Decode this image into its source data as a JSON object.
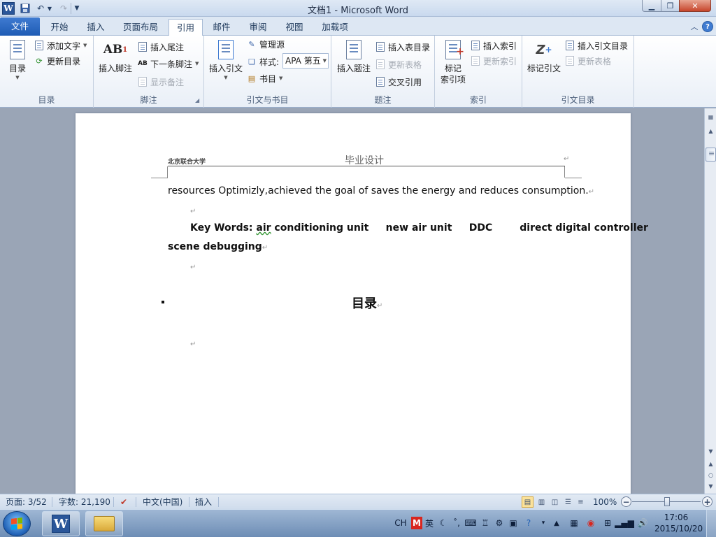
{
  "titlebar": {
    "title": "文档1 - Microsoft Word",
    "app_icon": "W"
  },
  "tabs": [
    {
      "label": "文件"
    },
    {
      "label": "开始"
    },
    {
      "label": "插入"
    },
    {
      "label": "页面布局"
    },
    {
      "label": "引用"
    },
    {
      "label": "邮件"
    },
    {
      "label": "审阅"
    },
    {
      "label": "视图"
    },
    {
      "label": "加载项"
    }
  ],
  "active_tab": "引用",
  "ribbon": {
    "toc": {
      "group_label": "目录",
      "toc_button": "目录",
      "add_text": "添加文字",
      "update_toc": "更新目录"
    },
    "footnotes": {
      "group_label": "脚注",
      "insert_footnote": "插入脚注",
      "insert_endnote": "插入尾注",
      "next_footnote": "下一条脚注",
      "show_notes": "显示备注"
    },
    "citations": {
      "group_label": "引文与书目",
      "insert_citation": "插入引文",
      "manage_sources": "管理源",
      "style_label": "样式:",
      "style_value": "APA 第五",
      "bibliography": "书目"
    },
    "captions": {
      "group_label": "题注",
      "insert_caption": "插入题注",
      "insert_table_of_figures": "插入表目录",
      "update_table": "更新表格",
      "cross_reference": "交叉引用"
    },
    "index": {
      "group_label": "索引",
      "mark_entry_line1": "标记",
      "mark_entry_line2": "索引项",
      "insert_index": "插入索引",
      "update_index": "更新索引"
    },
    "authorities": {
      "group_label": "引文目录",
      "mark_citation": "标记引文",
      "insert_toa": "插入引文目录",
      "update_table": "更新表格"
    }
  },
  "document": {
    "header_left": "北京联合大学",
    "header_center": "毕业设计",
    "para1": "resources Optimizly,achieved the goal of saves the energy and reduces consumption.",
    "kw_label": "Key Words:",
    "kw_first": "air",
    "kw_rest": " conditioning unit     new air unit     DDC        direct digital controller",
    "kw_line2": "scene debugging",
    "toc_heading": "目录",
    "mark": "↵"
  },
  "statusbar": {
    "page": "页面: 3/52",
    "words": "字数: 21,190",
    "language": "中文(中国)",
    "mode": "插入",
    "zoom": "100%",
    "zoom_minus": "−",
    "zoom_plus": "+"
  },
  "taskbar": {
    "tray_ch": "CH",
    "tray_m": "M",
    "tray_lang": "英",
    "time": "17:06",
    "date": "2015/10/20"
  },
  "colors": {
    "file_tab": "#2a62b8",
    "accent": "#2a5699",
    "close_button": "#c7452b"
  }
}
